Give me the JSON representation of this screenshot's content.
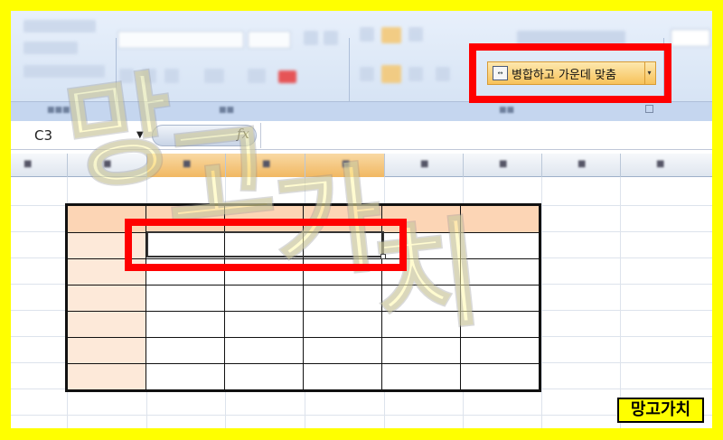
{
  "ribbon": {
    "merge_center_label": "병합하고 가운데 맞춤"
  },
  "formula_bar": {
    "name_box_value": "C3",
    "fx_label": "fx",
    "formula_value": ""
  },
  "watermark": {
    "chars": [
      "망",
      "고",
      "가",
      "치"
    ]
  },
  "brand": {
    "label": "망고가치"
  },
  "colors": {
    "highlight_red": "#ff0000",
    "frame_yellow": "#ffff00",
    "header_fill": "#fcd5b5",
    "side_fill": "#fde9d9"
  }
}
